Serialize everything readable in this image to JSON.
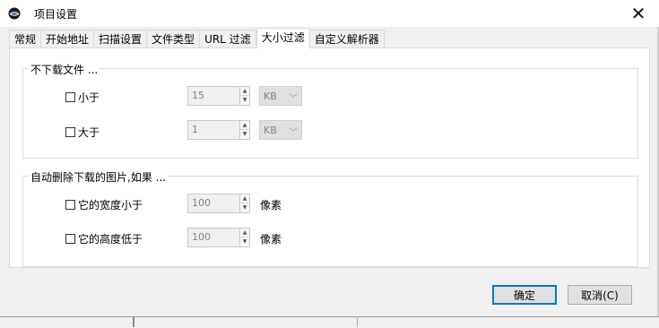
{
  "window": {
    "title": "项目设置",
    "close_glyph": "✕"
  },
  "tabs": [
    {
      "label": "常规"
    },
    {
      "label": "开始地址"
    },
    {
      "label": "扫描设置"
    },
    {
      "label": "文件类型"
    },
    {
      "label": "URL 过滤"
    },
    {
      "label": "大小过滤",
      "active": true
    },
    {
      "label": "自定义解析器"
    }
  ],
  "no_download": {
    "legend": "不下载文件 ...",
    "smaller": {
      "label": "小于",
      "checked": false,
      "value": "15",
      "unit": "KB"
    },
    "larger": {
      "label": "大于",
      "checked": false,
      "value": "1",
      "unit": "KB"
    }
  },
  "auto_delete": {
    "legend": "自动删除下载的图片,如果 ...",
    "width": {
      "label": "它的宽度小于",
      "checked": false,
      "value": "100",
      "unit": "像素"
    },
    "height": {
      "label": "它的高度低于",
      "checked": false,
      "value": "100",
      "unit": "像素"
    }
  },
  "buttons": {
    "ok": "确定",
    "cancel": "取消(C)"
  },
  "colors": {
    "accent": "#0078d7",
    "disabled_text": "#808080"
  }
}
